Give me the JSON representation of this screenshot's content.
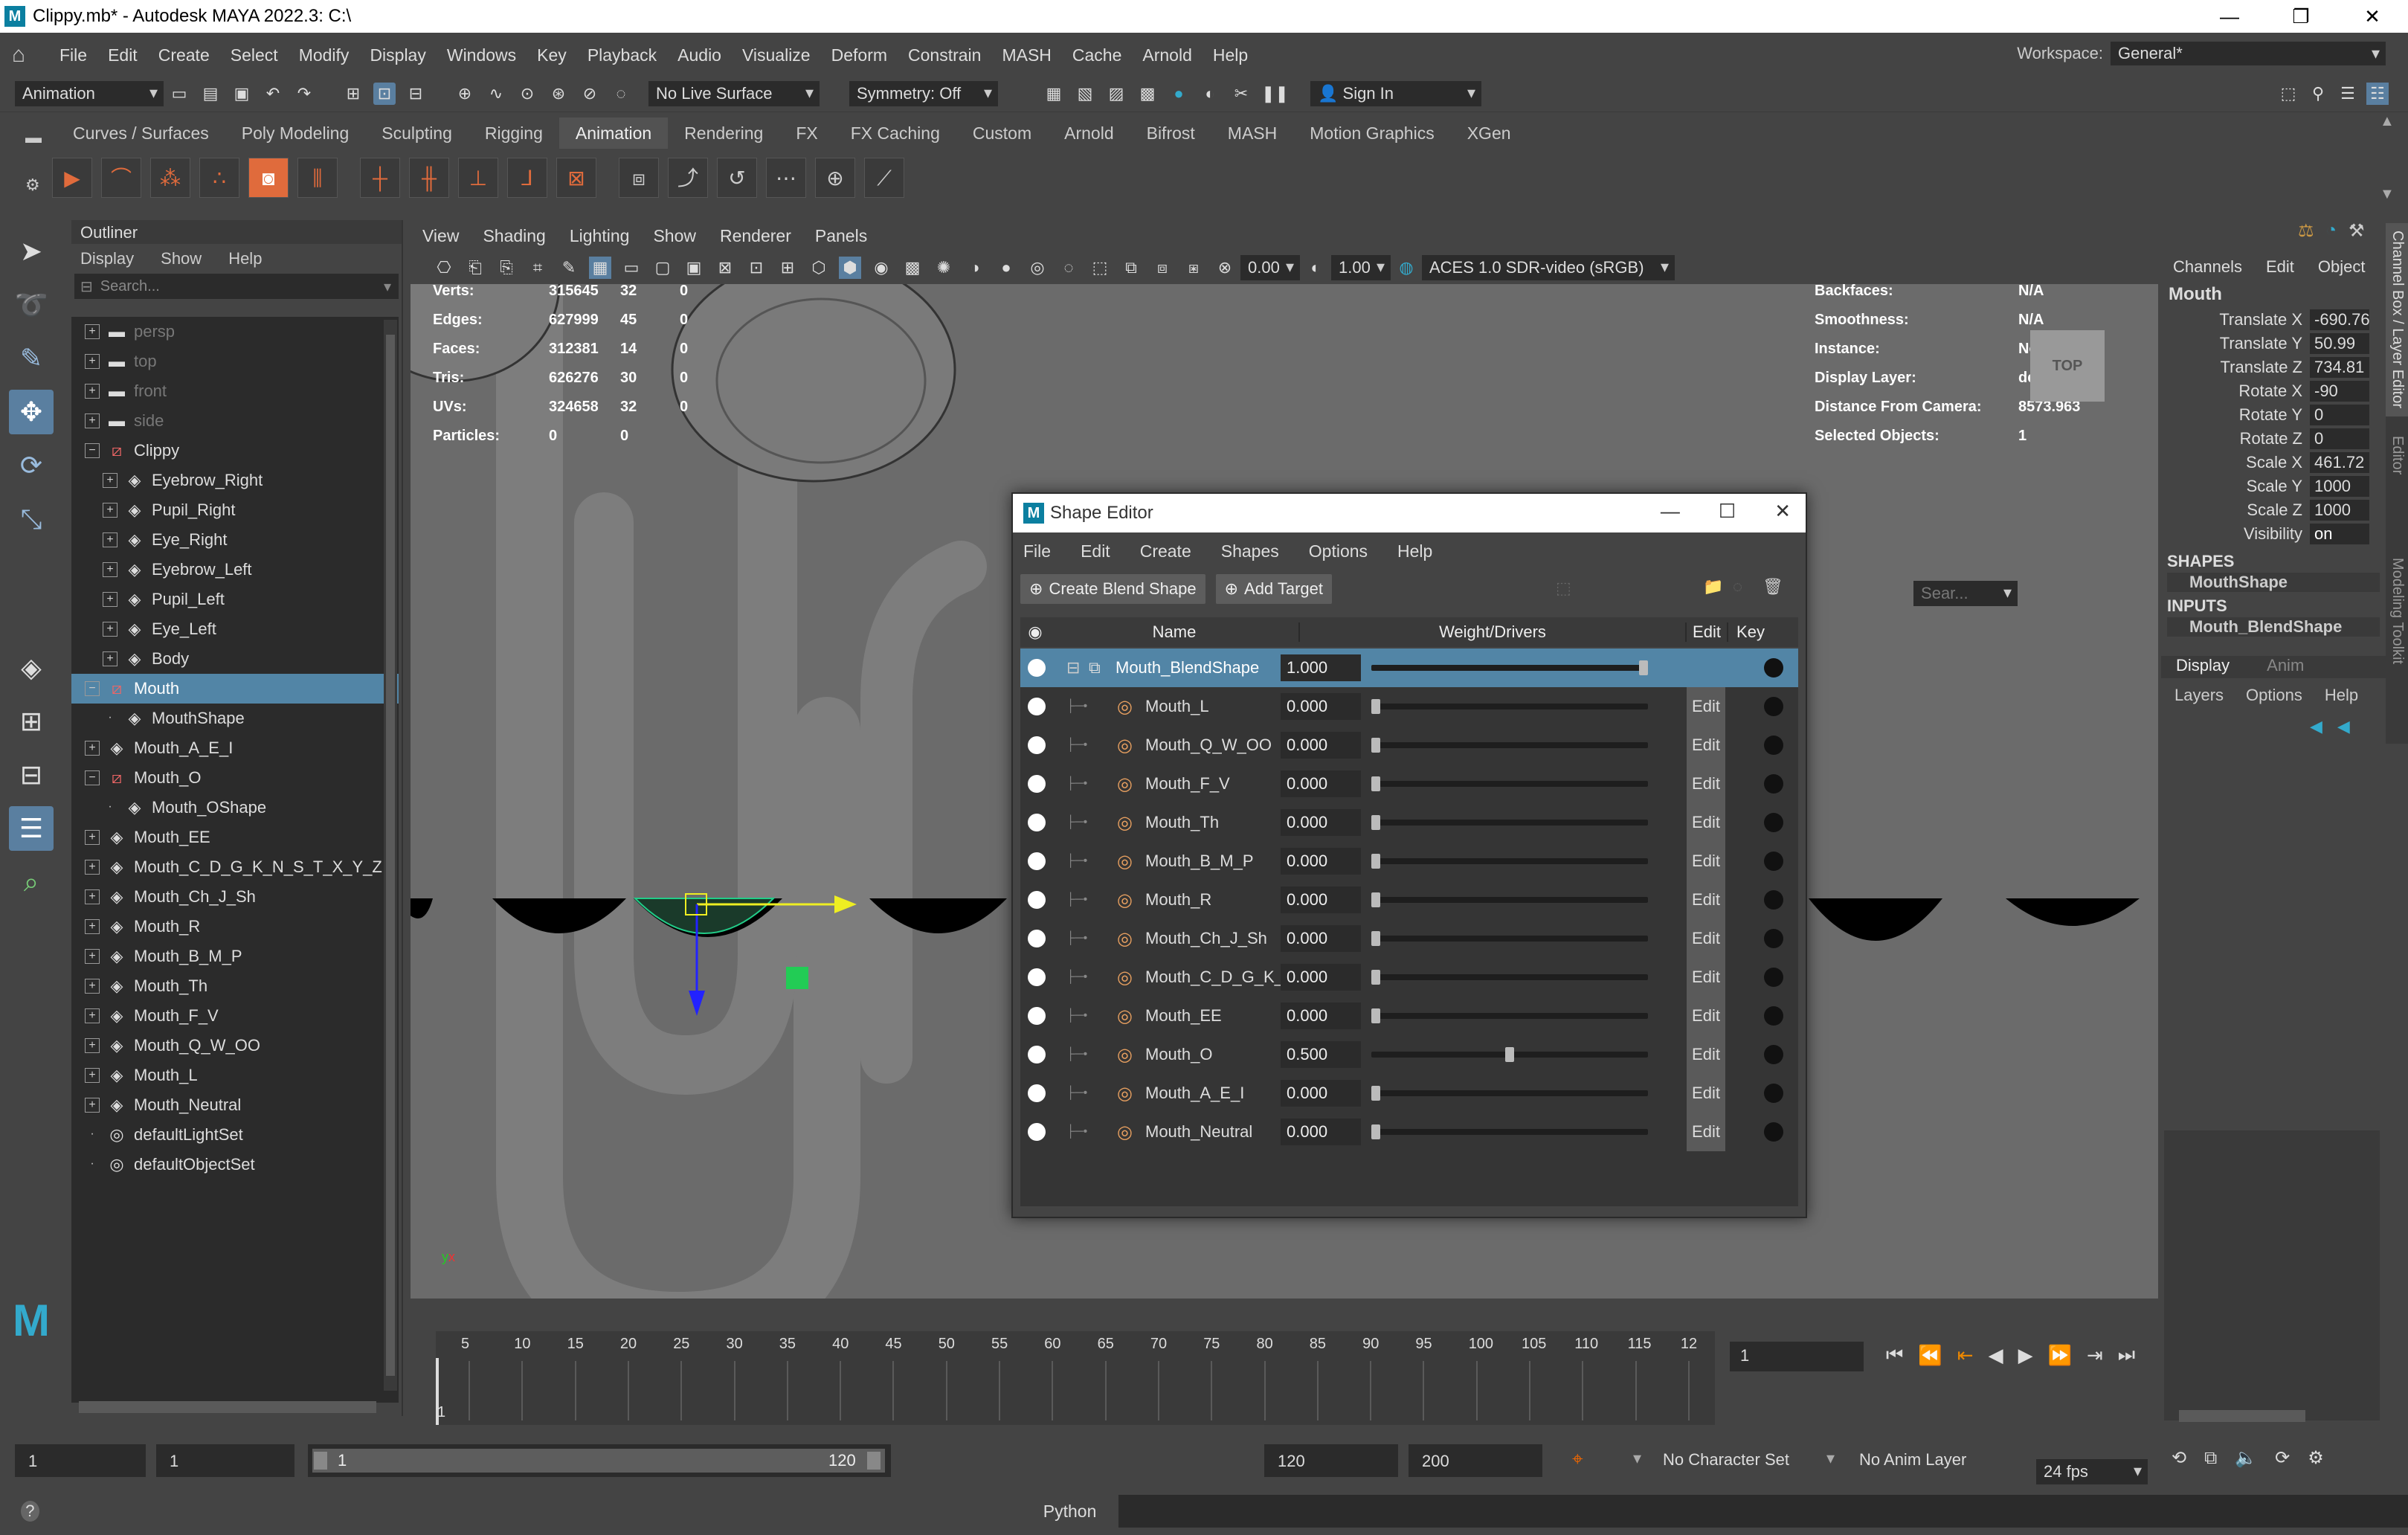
{
  "window": {
    "title": "Clippy.mb* - Autodesk MAYA 2022.3: C:\\",
    "controls": [
      "—",
      "❐",
      "✕"
    ]
  },
  "menu": [
    "File",
    "Edit",
    "Create",
    "Select",
    "Modify",
    "Display",
    "Windows",
    "Key",
    "Playback",
    "Audio",
    "Visualize",
    "Deform",
    "Constrain",
    "MASH",
    "Cache",
    "Arnold",
    "Help"
  ],
  "workspace": {
    "label": "Workspace:",
    "value": "General*"
  },
  "status": {
    "menuset": "Animation",
    "live": "No Live Surface",
    "symmetry": "Symmetry: Off",
    "signin": "Sign In"
  },
  "shelf_tabs": [
    "Curves / Surfaces",
    "Poly Modeling",
    "Sculpting",
    "Rigging",
    "Animation",
    "Rendering",
    "FX",
    "FX Caching",
    "Custom",
    "Arnold",
    "Bifrost",
    "MASH",
    "Motion Graphics",
    "XGen"
  ],
  "shelf_active": "Animation",
  "outliner": {
    "title": "Outliner",
    "menu": [
      "Display",
      "Show",
      "Help"
    ],
    "search": "Search...",
    "items": [
      {
        "label": "persp",
        "depth": 0,
        "exp": "+",
        "icon": "camera-icon",
        "dim": true
      },
      {
        "label": "top",
        "depth": 0,
        "exp": "+",
        "icon": "camera-icon",
        "dim": true
      },
      {
        "label": "front",
        "depth": 0,
        "exp": "+",
        "icon": "camera-icon",
        "dim": true
      },
      {
        "label": "side",
        "depth": 0,
        "exp": "+",
        "icon": "camera-icon",
        "dim": true
      },
      {
        "label": "Clippy",
        "depth": 0,
        "exp": "−",
        "icon": "group-icon"
      },
      {
        "label": "Eyebrow_Right",
        "depth": 1,
        "exp": "+",
        "icon": "mesh-icon"
      },
      {
        "label": "Pupil_Right",
        "depth": 1,
        "exp": "+",
        "icon": "mesh-icon"
      },
      {
        "label": "Eye_Right",
        "depth": 1,
        "exp": "+",
        "icon": "mesh-icon"
      },
      {
        "label": "Eyebrow_Left",
        "depth": 1,
        "exp": "+",
        "icon": "mesh-icon"
      },
      {
        "label": "Pupil_Left",
        "depth": 1,
        "exp": "+",
        "icon": "mesh-icon"
      },
      {
        "label": "Eye_Left",
        "depth": 1,
        "exp": "+",
        "icon": "mesh-icon"
      },
      {
        "label": "Body",
        "depth": 1,
        "exp": "+",
        "icon": "mesh-icon"
      },
      {
        "label": "Mouth",
        "depth": 0,
        "exp": "−",
        "icon": "group-icon",
        "selected": true
      },
      {
        "label": "MouthShape",
        "depth": 1,
        "exp": "",
        "icon": "mesh-icon"
      },
      {
        "label": "Mouth_A_E_I",
        "depth": 0,
        "exp": "+",
        "icon": "mesh-icon"
      },
      {
        "label": "Mouth_O",
        "depth": 0,
        "exp": "−",
        "icon": "group-icon"
      },
      {
        "label": "Mouth_OShape",
        "depth": 1,
        "exp": "",
        "icon": "mesh-icon"
      },
      {
        "label": "Mouth_EE",
        "depth": 0,
        "exp": "+",
        "icon": "mesh-icon"
      },
      {
        "label": "Mouth_C_D_G_K_N_S_T_X_Y_Z",
        "depth": 0,
        "exp": "+",
        "icon": "mesh-icon"
      },
      {
        "label": "Mouth_Ch_J_Sh",
        "depth": 0,
        "exp": "+",
        "icon": "mesh-icon"
      },
      {
        "label": "Mouth_R",
        "depth": 0,
        "exp": "+",
        "icon": "mesh-icon"
      },
      {
        "label": "Mouth_B_M_P",
        "depth": 0,
        "exp": "+",
        "icon": "mesh-icon"
      },
      {
        "label": "Mouth_Th",
        "depth": 0,
        "exp": "+",
        "icon": "mesh-icon"
      },
      {
        "label": "Mouth_F_V",
        "depth": 0,
        "exp": "+",
        "icon": "mesh-icon"
      },
      {
        "label": "Mouth_Q_W_OO",
        "depth": 0,
        "exp": "+",
        "icon": "mesh-icon"
      },
      {
        "label": "Mouth_L",
        "depth": 0,
        "exp": "+",
        "icon": "mesh-icon"
      },
      {
        "label": "Mouth_Neutral",
        "depth": 0,
        "exp": "+",
        "icon": "mesh-icon"
      },
      {
        "label": "defaultLightSet",
        "depth": 0,
        "exp": "",
        "icon": "set-icon"
      },
      {
        "label": "defaultObjectSet",
        "depth": 0,
        "exp": "",
        "icon": "set-icon"
      }
    ]
  },
  "viewport": {
    "menu": [
      "View",
      "Shading",
      "Lighting",
      "Show",
      "Renderer",
      "Panels"
    ],
    "near": "0.00",
    "far": "1.00",
    "colorspace": "ACES 1.0 SDR-video (sRGB)",
    "hud_left": [
      [
        "Verts:",
        "315645",
        "32",
        "0"
      ],
      [
        "Edges:",
        "627999",
        "45",
        "0"
      ],
      [
        "Faces:",
        "312381",
        "14",
        "0"
      ],
      [
        "Tris:",
        "626276",
        "30",
        "0"
      ],
      [
        "UVs:",
        "324658",
        "32",
        "0"
      ],
      [
        "Particles:",
        "0",
        "0",
        ""
      ]
    ],
    "hud_right": [
      [
        "Backfaces:",
        "N/A"
      ],
      [
        "Smoothness:",
        "N/A"
      ],
      [
        "Instance:",
        "No"
      ],
      [
        "Display Layer:",
        "default"
      ],
      [
        "Distance From Camera:",
        "8573.963"
      ],
      [
        "Selected Objects:",
        "1"
      ]
    ],
    "viewcube": "TOP"
  },
  "channelbox": {
    "tabs": [
      "Channels",
      "Edit",
      "Object"
    ],
    "object": "Mouth",
    "attrs": [
      [
        "Translate X",
        "-690.76"
      ],
      [
        "Translate Y",
        "50.99"
      ],
      [
        "Translate Z",
        "734.81"
      ],
      [
        "Rotate X",
        "-90"
      ],
      [
        "Rotate Y",
        "0"
      ],
      [
        "Rotate Z",
        "0"
      ],
      [
        "Scale X",
        "461.72"
      ],
      [
        "Scale Y",
        "1000"
      ],
      [
        "Scale Z",
        "1000"
      ],
      [
        "Visibility",
        "on"
      ]
    ],
    "shapes_h": "SHAPES",
    "shape": "MouthShape",
    "inputs_h": "INPUTS",
    "input": "Mouth_BlendShape",
    "layer_tabs": [
      "Display",
      "Anim"
    ],
    "layer_menu": [
      "Layers",
      "Options",
      "Help"
    ],
    "side_tabs": [
      "Channel Box / Layer Editor",
      "Attribute Editor",
      "Modeling Toolkit"
    ]
  },
  "shape_editor": {
    "title": "Shape Editor",
    "menu": [
      "File",
      "Edit",
      "Create",
      "Shapes",
      "Options",
      "Help"
    ],
    "create_btn": "Create Blend Shape",
    "add_btn": "Add Target",
    "search": "Sear...",
    "cols": {
      "name": "Name",
      "weight": "Weight/Drivers",
      "edit": "Edit",
      "key": "Key"
    },
    "blend": {
      "name": "Mouth_BlendShape",
      "weight": "1.000",
      "w": 1.0
    },
    "targets": [
      {
        "name": "Mouth_L",
        "weight": "0.000",
        "w": 0.0
      },
      {
        "name": "Mouth_Q_W_OO",
        "weight": "0.000",
        "w": 0.0
      },
      {
        "name": "Mouth_F_V",
        "weight": "0.000",
        "w": 0.0
      },
      {
        "name": "Mouth_Th",
        "weight": "0.000",
        "w": 0.0
      },
      {
        "name": "Mouth_B_M_P",
        "weight": "0.000",
        "w": 0.0
      },
      {
        "name": "Mouth_R",
        "weight": "0.000",
        "w": 0.0
      },
      {
        "name": "Mouth_Ch_J_Sh",
        "weight": "0.000",
        "w": 0.0
      },
      {
        "name": "Mouth_C_D_G_K_",
        "weight": "0.000",
        "w": 0.0
      },
      {
        "name": "Mouth_EE",
        "weight": "0.000",
        "w": 0.0
      },
      {
        "name": "Mouth_O",
        "weight": "0.500",
        "w": 0.5
      },
      {
        "name": "Mouth_A_E_I",
        "weight": "0.000",
        "w": 0.0
      },
      {
        "name": "Mouth_Neutral",
        "weight": "0.000",
        "w": 0.0
      }
    ],
    "edit_label": "Edit"
  },
  "timeline": {
    "ticks": [
      "5",
      "10",
      "15",
      "20",
      "25",
      "30",
      "35",
      "40",
      "45",
      "50",
      "55",
      "60",
      "65",
      "70",
      "75",
      "80",
      "85",
      "90",
      "95",
      "100",
      "105",
      "110",
      "115",
      "12"
    ],
    "first": "1",
    "current": "1"
  },
  "range": {
    "start": "1",
    "inner_start": "1",
    "slider_start": "1",
    "slider_end": "120",
    "end": "120",
    "max": "200",
    "charset": "No Character Set",
    "animlayer": "No Anim Layer",
    "fps": "24 fps"
  },
  "cmdline": {
    "lang": "Python"
  }
}
